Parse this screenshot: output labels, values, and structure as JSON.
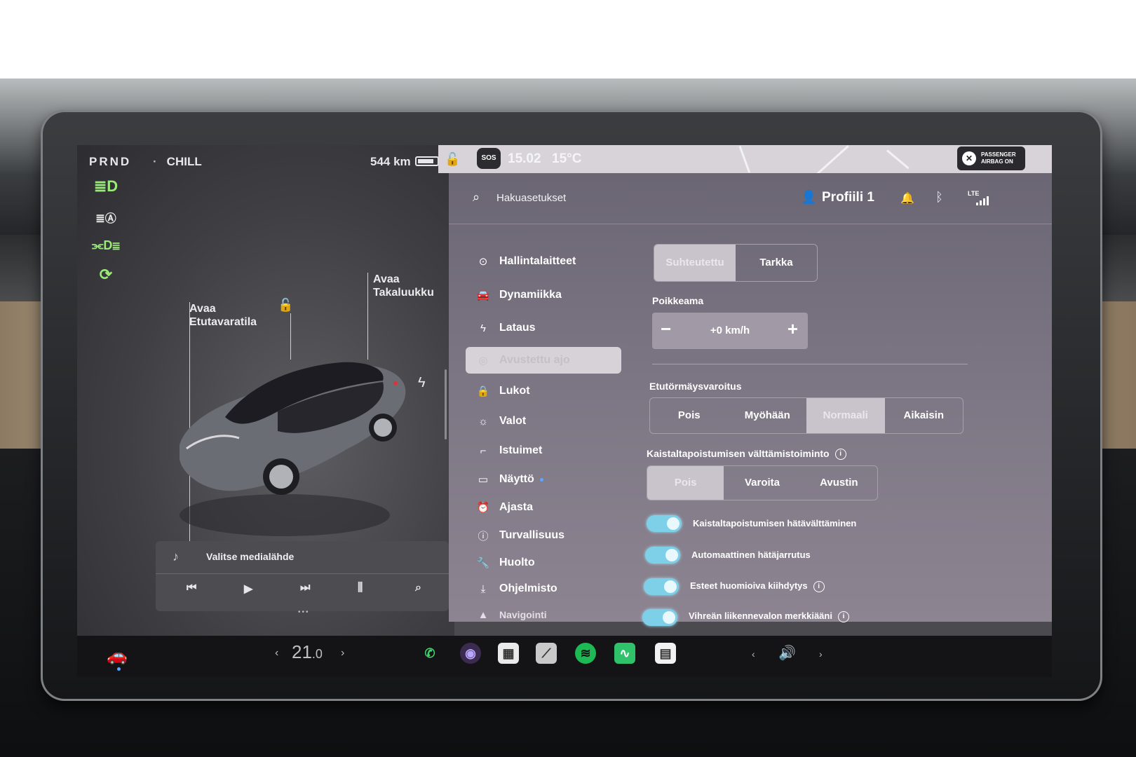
{
  "status": {
    "gear": "PRND",
    "mode": "CHILL",
    "range": "544 km"
  },
  "car_view": {
    "frunk_label": [
      "Avaa",
      "Etutavaratila"
    ],
    "trunk_label": [
      "Avaa",
      "Takaluukku"
    ]
  },
  "media": {
    "source_label": "Valitse medialähde"
  },
  "top_bar": {
    "time": "15.02",
    "temperature": "15°C",
    "sos": "SOS",
    "airbag": [
      "PASSENGER",
      "AIRBAG ON"
    ]
  },
  "header": {
    "search_label": "Hakuasetukset",
    "profile": "Profiili 1",
    "network": "LTE"
  },
  "menu": [
    {
      "label": "Hallintalaitteet",
      "icon": "toggle-icon"
    },
    {
      "label": "Dynamiikka",
      "icon": "car-icon"
    },
    {
      "label": "Lataus",
      "icon": "bolt-icon"
    },
    {
      "label": "Avustettu ajo",
      "icon": "steering-wheel-icon",
      "selected": true
    },
    {
      "label": "Lukot",
      "icon": "lock-icon"
    },
    {
      "label": "Valot",
      "icon": "sun-icon"
    },
    {
      "label": "Istuimet",
      "icon": "seat-icon"
    },
    {
      "label": "Näyttö",
      "icon": "display-icon"
    },
    {
      "label": "Ajasta",
      "icon": "alarm-icon"
    },
    {
      "label": "Turvallisuus",
      "icon": "info-icon"
    },
    {
      "label": "Huolto",
      "icon": "wrench-icon"
    },
    {
      "label": "Ohjelmisto",
      "icon": "download-icon"
    },
    {
      "label": "Navigointi",
      "icon": "navigation-icon"
    }
  ],
  "settings": {
    "speed_mode": {
      "options": [
        "Suhteutettu",
        "Tarkka"
      ],
      "selected": 0
    },
    "offset": {
      "label": "Poikkeama",
      "value": "+0 km/h"
    },
    "fcw": {
      "label": "Etutörmäysvaroitus",
      "options": [
        "Pois",
        "Myöhään",
        "Normaali",
        "Aikaisin"
      ],
      "selected": 2
    },
    "lane_departure": {
      "label": "Kaistaltapoistumisen välttämistoiminto",
      "options": [
        "Pois",
        "Varoita",
        "Avustin"
      ],
      "selected": 0
    },
    "toggles": [
      {
        "label": "Kaistaltapoistumisen hätävälttäminen",
        "on": true,
        "info": false
      },
      {
        "label": "Automaattinen hätäjarrutus",
        "on": true,
        "info": false
      },
      {
        "label": "Esteet huomioiva kiihdytys",
        "on": true,
        "info": true
      },
      {
        "label": "Vihreän liikennevalon merkkiääni",
        "on": true,
        "info": true
      }
    ]
  },
  "dock": {
    "cabin_temp_main": "21",
    "cabin_temp_decimal": ".0"
  },
  "colors": {
    "accent_toggle": "#7ecfe8",
    "light_indicator": "#9aea7a",
    "blue_dot": "#5aa8ff"
  }
}
